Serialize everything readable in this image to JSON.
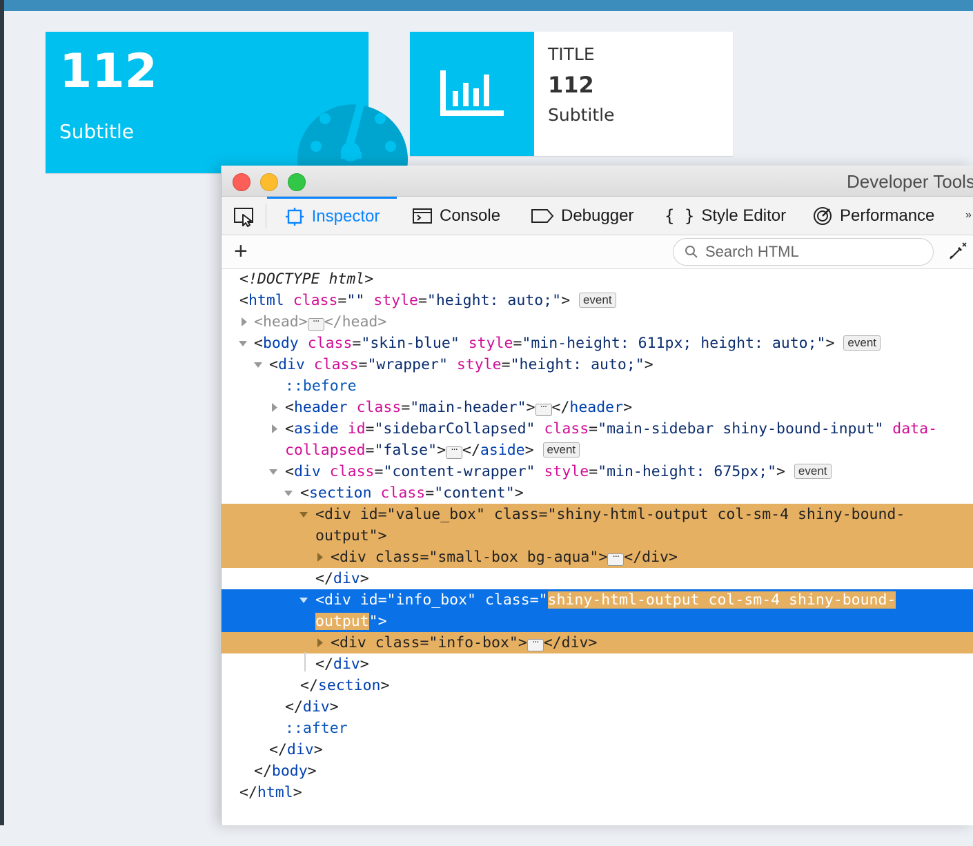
{
  "value_box": {
    "value": "112",
    "subtitle": "Subtitle",
    "icon": "tachometer-icon",
    "color": "#00c0ef"
  },
  "info_box": {
    "title": "TITLE",
    "value": "112",
    "subtitle": "Subtitle",
    "icon": "bar-chart-icon",
    "color": "#00c0ef"
  },
  "devtools": {
    "window_title": "Developer Tools",
    "tabs": [
      {
        "label": "Inspector",
        "icon": "inspector-icon",
        "selected": true
      },
      {
        "label": "Console",
        "icon": "console-icon",
        "selected": false
      },
      {
        "label": "Debugger",
        "icon": "debugger-icon",
        "selected": false
      },
      {
        "label": "Style Editor",
        "icon": "braces-icon",
        "selected": false
      },
      {
        "label": "Performance",
        "icon": "performance-icon",
        "selected": false
      }
    ],
    "search_placeholder": "Search HTML",
    "accent_color": "#0a84ff",
    "highlight_color": "#e6b062",
    "selection_color": "#0a71e6",
    "event_badge": "event",
    "markup": {
      "doctype": "<!DOCTYPE html>",
      "html_open": {
        "tag": "html",
        "a1": "class",
        "v1": "\"\"",
        "a2": "style",
        "v2": "\"height: auto;\""
      },
      "head": {
        "tag": "head"
      },
      "body": {
        "tag": "body",
        "a1": "class",
        "v1": "\"skin-blue\"",
        "a2": "style",
        "v2": "\"min-height: 611px; height: auto;\""
      },
      "wrapper": {
        "tag": "div",
        "a1": "class",
        "v1": "\"wrapper\"",
        "a2": "style",
        "v2": "\"height: auto;\""
      },
      "before": "::before",
      "header": {
        "tag": "header",
        "a1": "class",
        "v1": "\"main-header\""
      },
      "aside": {
        "tag": "aside",
        "a1": "id",
        "v1": "\"sidebarCollapsed\"",
        "a2": "class",
        "v2": "\"main-sidebar shiny-bound-input\"",
        "a3_part1": "data-",
        "a3_part2": "collapsed",
        "v3": "\"false\""
      },
      "content_wrapper": {
        "tag": "div",
        "a1": "class",
        "v1": "\"content-wrapper\"",
        "a2": "style",
        "v2": "\"min-height: 675px;\""
      },
      "section": {
        "tag": "section",
        "a1": "class",
        "v1": "\"content\""
      },
      "value_box_div": {
        "text1": "<div id=\"value_box\" class=\"shiny-html-output col-sm-4 shiny-bound-",
        "text2": "output\">"
      },
      "small_box_div": {
        "text": "<div class=\"small-box bg-aqua\">",
        "close": "</div>"
      },
      "div_close": "</div>",
      "info_box_div": {
        "prefix": "<div id=\"info_box\" class=\"",
        "sel1": "shiny-html-output col-sm-4 shiny-bound-",
        "sel2": "output",
        "suffix": "\">"
      },
      "info_box_inner": {
        "text": "<div class=\"info-box\">",
        "close": "</div>"
      },
      "section_close": "section",
      "div_tag": "div",
      "after": "::after",
      "body_close": "body",
      "html_close": "html"
    }
  }
}
